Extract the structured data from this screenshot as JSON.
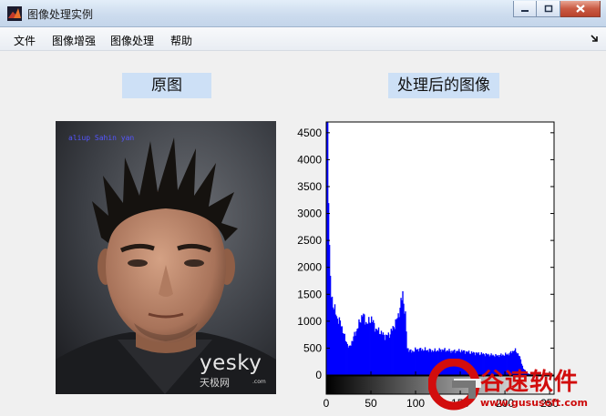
{
  "window": {
    "title": "图像处理实例",
    "icon": "matlab-icon",
    "buttons": [
      "minimize",
      "maximize",
      "close"
    ]
  },
  "menu": {
    "items": [
      "文件",
      "图像增强",
      "图像处理",
      "帮助"
    ],
    "overflow_icon": "dock-arrow-icon"
  },
  "panels": {
    "original_title": "原图",
    "processed_title": "处理后的图像"
  },
  "photo": {
    "caption": "aliup  Sahin  yan",
    "watermark_main": "yesky",
    "watermark_sub": "天极网",
    "watermark_domain": ".com"
  },
  "chart_data": {
    "type": "histogram",
    "title": "",
    "xlabel": "",
    "ylabel": "",
    "xlim": [
      0,
      255
    ],
    "ylim": [
      0,
      4700
    ],
    "xticks": [
      0,
      50,
      100,
      150,
      200,
      250
    ],
    "yticks": [
      0,
      500,
      1000,
      1500,
      2000,
      2500,
      3000,
      3500,
      4000,
      4500
    ],
    "bar_color": "#0000ff",
    "colorbar": "grayscale 0-255",
    "bins": [
      [
        0,
        4700
      ],
      [
        1,
        4700
      ],
      [
        2,
        3500
      ],
      [
        3,
        2300
      ],
      [
        4,
        1750
      ],
      [
        5,
        1500
      ],
      [
        8,
        1250
      ],
      [
        12,
        1050
      ],
      [
        16,
        950
      ],
      [
        20,
        700
      ],
      [
        25,
        500
      ],
      [
        30,
        700
      ],
      [
        35,
        900
      ],
      [
        40,
        1130
      ],
      [
        45,
        950
      ],
      [
        50,
        1050
      ],
      [
        55,
        850
      ],
      [
        60,
        800
      ],
      [
        65,
        720
      ],
      [
        70,
        750
      ],
      [
        75,
        900
      ],
      [
        80,
        1100
      ],
      [
        85,
        1500
      ],
      [
        88,
        1100
      ],
      [
        90,
        500
      ],
      [
        95,
        430
      ],
      [
        100,
        480
      ],
      [
        110,
        470
      ],
      [
        120,
        450
      ],
      [
        130,
        470
      ],
      [
        140,
        440
      ],
      [
        150,
        450
      ],
      [
        160,
        420
      ],
      [
        170,
        400
      ],
      [
        180,
        380
      ],
      [
        190,
        360
      ],
      [
        200,
        380
      ],
      [
        205,
        400
      ],
      [
        210,
        470
      ],
      [
        215,
        380
      ],
      [
        220,
        120
      ],
      [
        225,
        30
      ],
      [
        230,
        0
      ]
    ]
  },
  "brand": {
    "name": "谷速软件",
    "url": "www.gususoft.com",
    "logo_icon": "g-logo-icon",
    "colors": {
      "red": "#d20d0d",
      "grey": "#777777"
    }
  }
}
